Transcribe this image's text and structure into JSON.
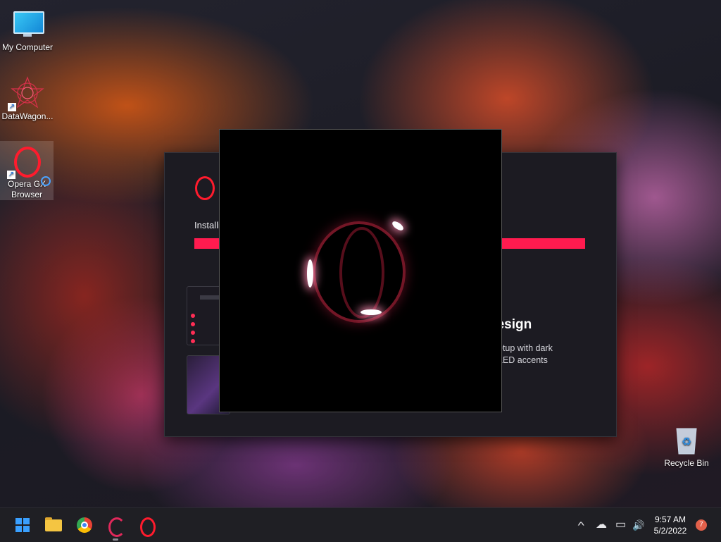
{
  "desktop": {
    "icons": [
      {
        "label": "My Computer",
        "icon": "monitor-icon"
      },
      {
        "label": "DataWagon...",
        "icon": "datawagon-icon"
      },
      {
        "label": "Opera GX Browser",
        "icon": "opera-gx-icon"
      },
      {
        "label": "Recycle Bin",
        "icon": "recycle-bin-icon"
      }
    ]
  },
  "installer": {
    "install_label": "Installi",
    "progress": 1.0,
    "feature_title": "design",
    "feature_desc_line1": "etup with dark",
    "feature_desc_line2": "LED accents",
    "accent_color": "#ff1b4f"
  },
  "splash": {
    "brand_color": "#ff1b2d"
  },
  "taskbar": {
    "apps": [
      "start-icon",
      "file-explorer-icon",
      "chrome-icon",
      "opera-gx-icon",
      "opera-icon"
    ],
    "tray": {
      "chevron": "^",
      "cloud": "☁",
      "network": "▭",
      "volume": "🔊"
    },
    "time": "9:57 AM",
    "date": "5/2/2022",
    "notification_count": "7"
  }
}
